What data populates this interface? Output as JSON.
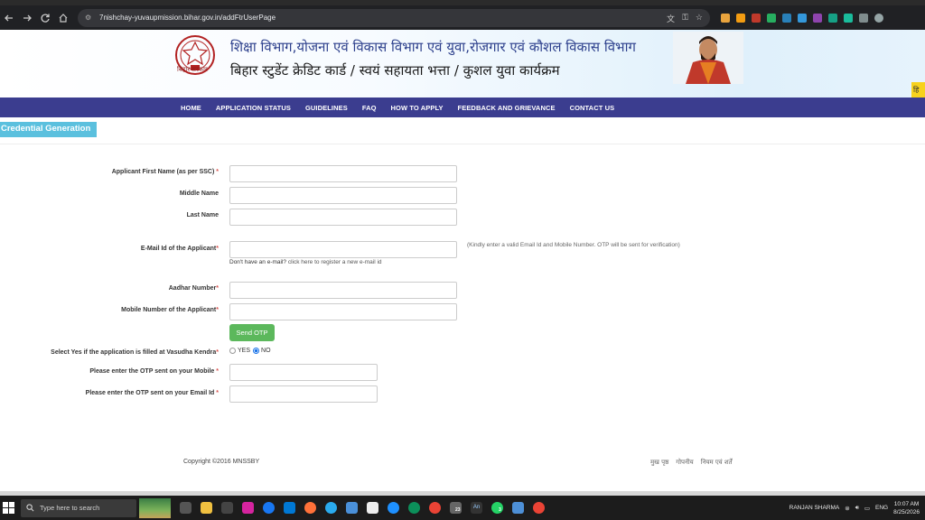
{
  "browser": {
    "url": "7nishchay-yuvaupmission.bihar.gov.in/addFtrUserPage",
    "icons": [
      "back-icon",
      "forward-icon",
      "reload-icon",
      "home-icon",
      "site-info-icon",
      "translate-icon",
      "key-icon",
      "star-icon",
      "download-icon",
      "profile-icon"
    ]
  },
  "header": {
    "title_line1": "शिक्षा विभाग,योजना एवं विकास विभाग एवं युवा,रोजगार एवं कौशल विकास विभाग",
    "title_line2": "बिहार स्टुडेंट क्रेडिट कार्ड / स्वयं सहायता भत्ता / कुशल युवा कार्यक्रम",
    "logo_caption": "बिहार सरकार",
    "lang_tab": "हि"
  },
  "nav": {
    "items": [
      "HOME",
      "APPLICATION STATUS",
      "GUIDELINES",
      "FAQ",
      "HOW TO APPLY",
      "FEEDBACK AND GRIEVANCE",
      "CONTACT US"
    ]
  },
  "section_title": "Credential Generation",
  "form": {
    "first_name_label": "Applicant First Name (as per SSC)",
    "middle_name_label": "Middle Name",
    "last_name_label": "Last Name",
    "email_label": "E-Mail Id of the Applicant",
    "email_hint": "(Kindly enter a valid Email Id and Mobile Number. OTP will be sent for verification)",
    "no_email_text": "Don't have an e-mail?",
    "no_email_link": "click here to register a new e-mail id",
    "aadhar_label": "Aadhar Number",
    "mobile_label": "Mobile Number of the Applicant",
    "send_otp_button": "Send OTP",
    "vasudha_label": "Select Yes if the application is filled at Vasudha Kendra",
    "yes_label": "YES",
    "no_label": "NO",
    "vasudha_selected": "NO",
    "otp_mobile_label": "Please enter the OTP sent on your Mobile",
    "otp_email_label": "Please enter the OTP sent on your Email Id",
    "required_mark": "*",
    "colors": {
      "required": "#d9534f",
      "button": "#5cb85c",
      "tab": "#5bc0de",
      "nav": "#3b3d8f"
    }
  },
  "footer": {
    "copyright": "Copyright ©2016 MNSSBY",
    "links": [
      "मुख पृष्ठ",
      "गोपनीय",
      "नियम एवं शर्तें"
    ]
  },
  "taskbar": {
    "search_placeholder": "Type here to search",
    "user_name": "RANJAN SHARMA",
    "language": "ENG",
    "time": "10:07 AM",
    "date": "8/25/2026",
    "badge_1": "23",
    "badge_2": "An",
    "badge_3": "3"
  }
}
